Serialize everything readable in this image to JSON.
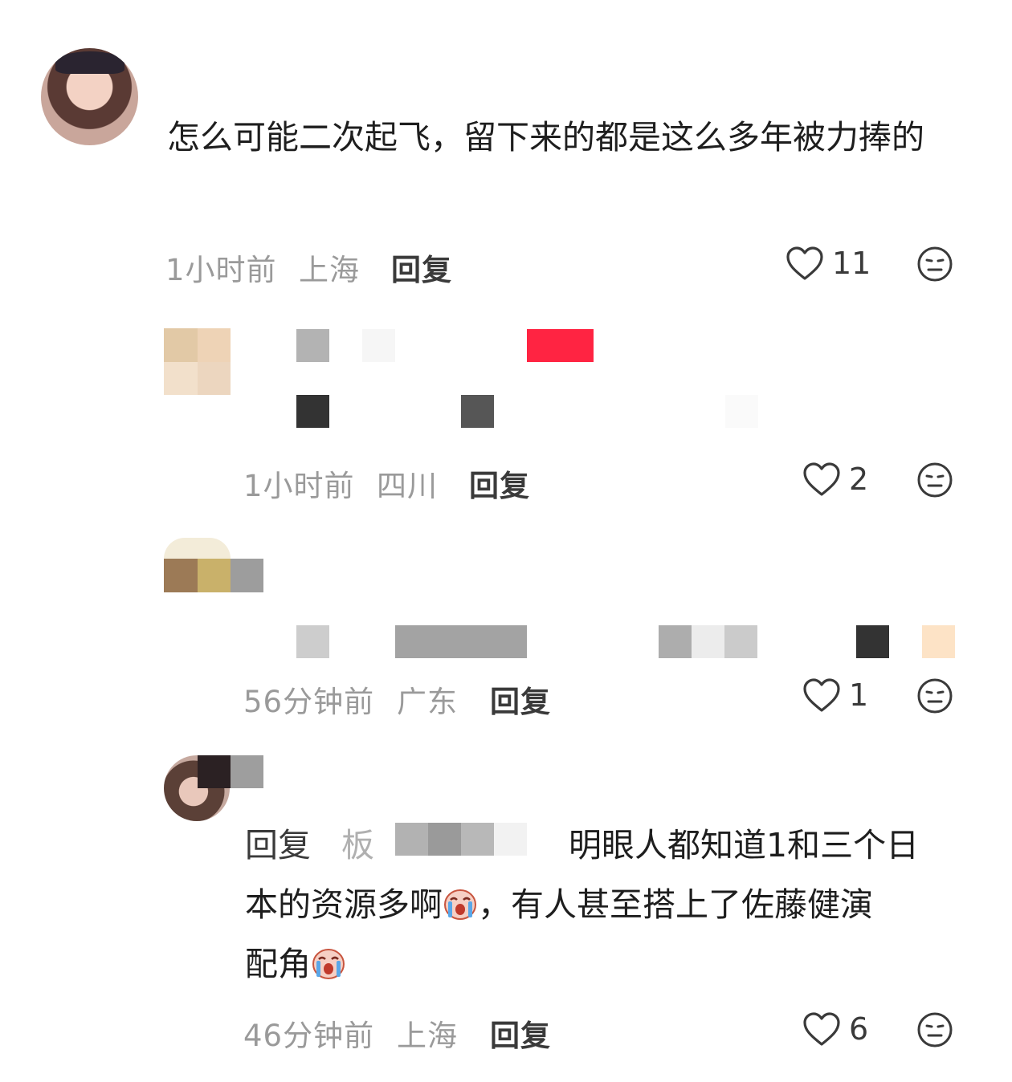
{
  "comments": [
    {
      "text": "怎么可能二次起飞，留下来的都是这么多年被力捧的",
      "time": "1小时前",
      "location": "上海",
      "reply_label": "回复",
      "likes": "11"
    },
    {
      "time": "1小时前",
      "location": "四川",
      "reply_label": "回复",
      "likes": "2"
    },
    {
      "time": "56分钟前",
      "location": "广东",
      "reply_label": "回复",
      "likes": "1"
    },
    {
      "reply_prefix": "回复",
      "reply_target": "板",
      "text_line1": "明眼人都知道1和三个日",
      "text_line2a": "本的资源多啊",
      "text_line2b": "，有人甚至搭上了佐藤健演",
      "text_line3": "配角",
      "time": "46分钟前",
      "location": "上海",
      "reply_label": "回复",
      "likes": "6"
    }
  ],
  "colors": {
    "accent_red": "#ff2442",
    "meta_gray": "#9a9a9a"
  },
  "icons": [
    "heart-outline-icon",
    "dislike-face-icon",
    "crying-face-emoji"
  ]
}
